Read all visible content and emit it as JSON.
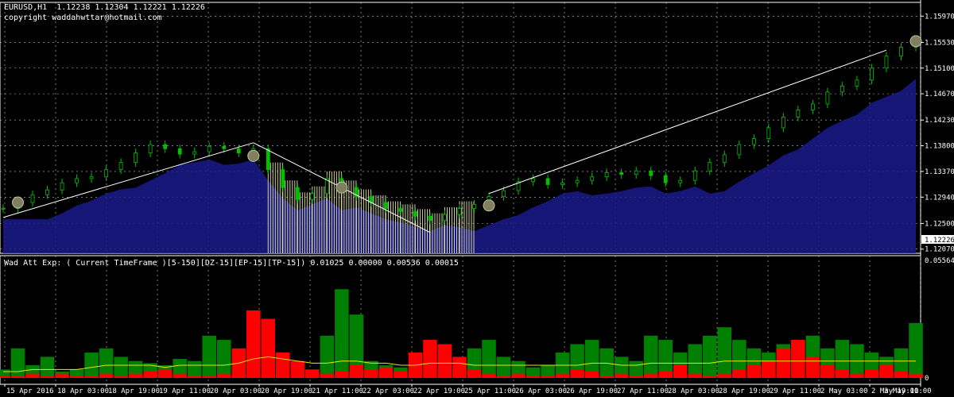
{
  "header": {
    "symbol": "EURUSD,H1",
    "ohlc": "1.12238 1.12304 1.12221 1.12226",
    "copyright": "copyright waddahwttar@hotmail.com"
  },
  "indicator": {
    "title": "Wad Att Exp: ( Current TimeFrame )[5-150][DZ-15][EP-15][TP-15]) 0.01025 0.00000 0.00536 0.00015"
  },
  "colors": {
    "background": "#000000",
    "grid": "#c0c0c0",
    "candle": "#00c000",
    "cloud": "#1a1a8c",
    "cloud_edge": "#2a2acc",
    "vertical_fill": "#e8e8b0",
    "trend_line": "#ffffff",
    "bull_hist": "#008000",
    "bear_hist": "#ff0000",
    "signal_line": "#e8e800"
  },
  "chart_data": [
    {
      "type": "line",
      "name": "EURUSD,H1",
      "y_ticks": [
        "1.15970",
        "1.15530",
        "1.15100",
        "1.14670",
        "1.14230",
        "1.13800",
        "1.13370",
        "1.12940",
        "1.12500",
        "1.12226",
        "1.12070"
      ],
      "current_price": "1.12226",
      "ylim": [
        1.12,
        1.162
      ],
      "x_ticks": [
        "15 Apr 2016",
        "18 Apr 03:00",
        "18 Apr 19:00",
        "19 Apr 11:00",
        "20 Apr 03:00",
        "20 Apr 19:00",
        "21 Apr 11:00",
        "22 Apr 03:00",
        "22 Apr 19:00",
        "25 Apr 11:00",
        "26 Apr 03:00",
        "26 Apr 19:00",
        "27 Apr 11:00",
        "28 Apr 03:00",
        "28 Apr 19:00",
        "29 Apr 11:00",
        "2 May 03:00",
        "2 May 19:00",
        "3 May 11:00"
      ],
      "close_series": [
        1.1275,
        1.1285,
        1.1298,
        1.1306,
        1.1318,
        1.1325,
        1.1328,
        1.134,
        1.1352,
        1.1368,
        1.1382,
        1.1375,
        1.1366,
        1.137,
        1.1379,
        1.1375,
        1.1368,
        1.1375,
        1.134,
        1.131,
        1.129,
        1.13,
        1.1325,
        1.131,
        1.1295,
        1.1285,
        1.1275,
        1.127,
        1.1262,
        1.1255,
        1.1265,
        1.1275,
        1.1282,
        1.1295,
        1.1305,
        1.132,
        1.1325,
        1.1315,
        1.1318,
        1.1322,
        1.1328,
        1.1335,
        1.1332,
        1.1338,
        1.133,
        1.1318,
        1.1322,
        1.1338,
        1.1352,
        1.1365,
        1.1382,
        1.1392,
        1.141,
        1.1428,
        1.144,
        1.145,
        1.147,
        1.148,
        1.149,
        1.151,
        1.153,
        1.1545,
        1.1555
      ]
    },
    {
      "type": "bar",
      "name": "Wad Att Exp",
      "y_ticks": [
        "0.05564",
        "0"
      ],
      "ylim": [
        0,
        0.05564
      ],
      "bull_values": [
        0.004,
        0.014,
        0.006,
        0.01,
        0.003,
        0.004,
        0.012,
        0.014,
        0.01,
        0.008,
        0.007,
        0.006,
        0.009,
        0.008,
        0.02,
        0.018,
        0.012,
        0.004,
        0.003,
        0.002,
        0.002,
        0.004,
        0.02,
        0.042,
        0.03,
        0.008,
        0.006,
        0.005,
        0.004,
        0.003,
        0.002,
        0.006,
        0.014,
        0.018,
        0.01,
        0.008,
        0.005,
        0.006,
        0.012,
        0.016,
        0.018,
        0.014,
        0.01,
        0.008,
        0.02,
        0.018,
        0.012,
        0.016,
        0.02,
        0.024,
        0.018,
        0.014,
        0.012,
        0.016,
        0.018,
        0.02,
        0.014,
        0.018,
        0.016,
        0.012,
        0.01,
        0.014,
        0.026
      ],
      "bear_values": [
        0.001,
        0.001,
        0.002,
        0.001,
        0.002,
        0.001,
        0.001,
        0.002,
        0.001,
        0.002,
        0.003,
        0.004,
        0.002,
        0.001,
        0.001,
        0.002,
        0.014,
        0.032,
        0.028,
        0.012,
        0.008,
        0.004,
        0.002,
        0.003,
        0.006,
        0.004,
        0.005,
        0.003,
        0.012,
        0.018,
        0.016,
        0.01,
        0.004,
        0.002,
        0.001,
        0.002,
        0.001,
        0.001,
        0.002,
        0.004,
        0.003,
        0.001,
        0.002,
        0.001,
        0.002,
        0.003,
        0.006,
        0.002,
        0.001,
        0.002,
        0.004,
        0.006,
        0.008,
        0.014,
        0.018,
        0.01,
        0.006,
        0.004,
        0.002,
        0.004,
        0.006,
        0.003,
        0.002
      ],
      "signal_values": [
        0.003,
        0.003,
        0.004,
        0.004,
        0.004,
        0.004,
        0.005,
        0.006,
        0.006,
        0.006,
        0.006,
        0.005,
        0.006,
        0.006,
        0.006,
        0.006,
        0.007,
        0.009,
        0.01,
        0.009,
        0.008,
        0.007,
        0.007,
        0.008,
        0.008,
        0.007,
        0.007,
        0.006,
        0.006,
        0.007,
        0.007,
        0.007,
        0.006,
        0.006,
        0.006,
        0.006,
        0.006,
        0.006,
        0.006,
        0.006,
        0.007,
        0.007,
        0.006,
        0.006,
        0.007,
        0.007,
        0.007,
        0.007,
        0.007,
        0.008,
        0.008,
        0.008,
        0.008,
        0.008,
        0.008,
        0.008,
        0.008,
        0.008,
        0.008,
        0.008,
        0.008,
        0.008,
        0.008
      ]
    }
  ]
}
